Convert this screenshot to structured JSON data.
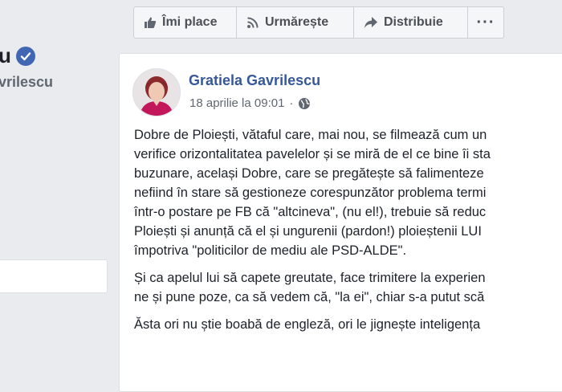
{
  "profile": {
    "name": "u",
    "handle": "vrilescu"
  },
  "action_bar": {
    "like_label": "Îmi place",
    "follow_label": "Urmărește",
    "share_label": "Distribuie",
    "more_label": "···"
  },
  "post": {
    "author": "Gratiela Gavrilescu",
    "timestamp": "18 aprilie la 09:01",
    "separator": "·",
    "paragraphs": [
      [
        "Dobre de Ploiești, vătaful care, mai nou, se filmează cum un",
        "verifice orizontalitatea pavelelor și se miră de el ce bine îi sta",
        "buzunare, același Dobre, care se pregătește să falimenteze",
        "nefiind în stare să gestioneze corespunzător problema termi",
        "într-o postare pe FB că \"altcineva\", (nu el!), trebuie să reduc",
        "Ploiești și anunță că el și ungurenii (pardon!) ploieștenii LUI",
        "împotriva \"politicilor de mediu ale PSD-ALDE\"."
      ],
      [
        "Și ca apelul lui să capete greutate, face trimitere la experien",
        "ne și pune poze, ca să vedem că, \"la ei\", chiar s-a putut scă"
      ],
      [
        "Ăsta ori nu știe boabă de engleză, ori le jignește inteligența"
      ]
    ]
  },
  "colors": {
    "author_link": "#365899",
    "verified_badge": "#4267b2",
    "background": "#e9ebee"
  }
}
